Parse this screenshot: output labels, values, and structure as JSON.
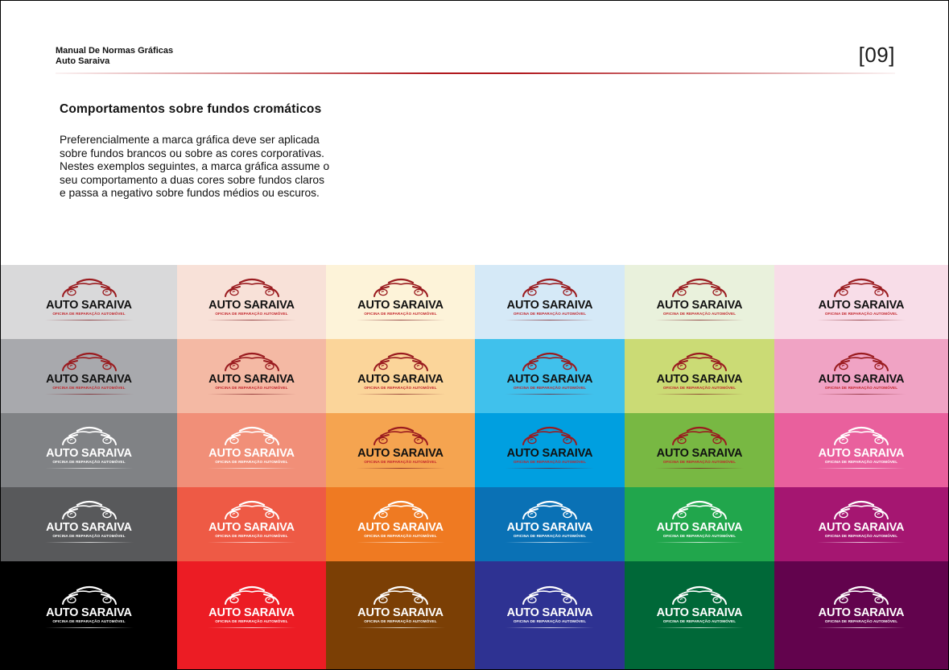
{
  "header": {
    "doc_title": "Manual De Normas Gráficas",
    "brand": "Auto Saraiva",
    "page_number": "[09]",
    "rule_color": "#b0171c"
  },
  "section": {
    "title": "Comportamentos sobre fundos cromáticos",
    "body": "Preferencialmente a marca gráfica deve ser aplicada sobre fundos brancos ou sobre as cores corporativas. Nestes exemplos seguintes, a marca gráfica assume o seu comportamento a duas cores sobre fundos claros e passa a negativo sobre fundos médios ou escuros."
  },
  "logo": {
    "name": "AUTO SARAIVA",
    "tagline": "OFICINA DE REPARAÇÃO AUTOMÓVEL",
    "icon": "car-front-icon"
  },
  "palette": {
    "positive_car": "#9a1b1f",
    "positive_text": "#111111",
    "positive_tag": "#c2262c",
    "negative": "#ffffff"
  },
  "swatches": [
    [
      {
        "bg": "#d9d9da",
        "mode": "positive"
      },
      {
        "bg": "#f8e1d8",
        "mode": "positive"
      },
      {
        "bg": "#fdf3d9",
        "mode": "positive"
      },
      {
        "bg": "#d5e9f7",
        "mode": "positive"
      },
      {
        "bg": "#e9f1dc",
        "mode": "positive"
      },
      {
        "bg": "#f8dde8",
        "mode": "positive"
      }
    ],
    [
      {
        "bg": "#a8a9ad",
        "mode": "positive"
      },
      {
        "bg": "#f4b9a4",
        "mode": "positive"
      },
      {
        "bg": "#fbd59a",
        "mode": "positive"
      },
      {
        "bg": "#40c1ec",
        "mode": "positive"
      },
      {
        "bg": "#cbdb75",
        "mode": "positive"
      },
      {
        "bg": "#f0a3c4",
        "mode": "positive"
      }
    ],
    [
      {
        "bg": "#808285",
        "mode": "negative"
      },
      {
        "bg": "#f18f78",
        "mode": "negative"
      },
      {
        "bg": "#f5a450",
        "mode": "positive"
      },
      {
        "bg": "#009fe0",
        "mode": "positive"
      },
      {
        "bg": "#78b843",
        "mode": "positive"
      },
      {
        "bg": "#e9609d",
        "mode": "negative"
      }
    ],
    [
      {
        "bg": "#58595b",
        "mode": "negative"
      },
      {
        "bg": "#ee5a45",
        "mode": "negative"
      },
      {
        "bg": "#ef7a22",
        "mode": "negative"
      },
      {
        "bg": "#0a71b5",
        "mode": "negative"
      },
      {
        "bg": "#21a64c",
        "mode": "negative"
      },
      {
        "bg": "#a51671",
        "mode": "negative"
      }
    ],
    [
      {
        "bg": "#000000",
        "mode": "negative"
      },
      {
        "bg": "#ec1c24",
        "mode": "negative"
      },
      {
        "bg": "#7b3f05",
        "mode": "negative"
      },
      {
        "bg": "#2e3292",
        "mode": "negative"
      },
      {
        "bg": "#006838",
        "mode": "negative"
      },
      {
        "bg": "#62034d",
        "mode": "negative"
      }
    ]
  ]
}
